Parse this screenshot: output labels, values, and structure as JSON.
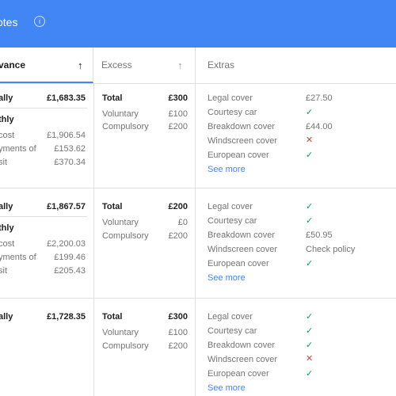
{
  "header": {
    "title": "otes",
    "info_icon": "info-icon"
  },
  "columns": {
    "advance": "vance",
    "excess": "Excess",
    "extras": "Extras",
    "sort_arrow": "↑"
  },
  "quotes": [
    {
      "annual_label": "ally",
      "annual_price": "£1,683.35",
      "monthly": {
        "label": "thly",
        "lines": [
          {
            "label": "cost",
            "value": "£1,906.54"
          },
          {
            "label": "yments of",
            "value": "£153.62"
          },
          {
            "label": "sit",
            "value": "£370.34"
          }
        ]
      },
      "excess": {
        "total_label": "Total",
        "total": "£300",
        "voluntary_label": "Voluntary",
        "voluntary": "£100",
        "compulsory_label": "Compulsory",
        "compulsory": "£200"
      },
      "extras": [
        {
          "label": "Legal cover",
          "value": "£27.50",
          "kind": "text"
        },
        {
          "label": "Courtesy car",
          "value": "✓",
          "kind": "yes"
        },
        {
          "label": "Breakdown cover",
          "value": "£44.00",
          "kind": "text"
        },
        {
          "label": "Windscreen cover",
          "value": "✕",
          "kind": "no"
        },
        {
          "label": "European cover",
          "value": "✓",
          "kind": "yes"
        }
      ],
      "see_more": "See more"
    },
    {
      "annual_label": "ally",
      "annual_price": "£1,867.57",
      "monthly": {
        "label": "thly",
        "lines": [
          {
            "label": "cost",
            "value": "£2,200.03"
          },
          {
            "label": "yments of",
            "value": "£199.46"
          },
          {
            "label": "sit",
            "value": "£205.43"
          }
        ]
      },
      "excess": {
        "total_label": "Total",
        "total": "£200",
        "voluntary_label": "Voluntary",
        "voluntary": "£0",
        "compulsory_label": "Compulsory",
        "compulsory": "£200"
      },
      "extras": [
        {
          "label": "Legal cover",
          "value": "✓",
          "kind": "yes"
        },
        {
          "label": "Courtesy car",
          "value": "✓",
          "kind": "yes"
        },
        {
          "label": "Breakdown cover",
          "value": "£50.95",
          "kind": "text"
        },
        {
          "label": "Windscreen cover",
          "value": "Check policy",
          "kind": "text"
        },
        {
          "label": "European cover",
          "value": "✓",
          "kind": "yes"
        }
      ],
      "see_more": "See more"
    },
    {
      "annual_label": "ally",
      "annual_price": "£1,728.35",
      "excess": {
        "total_label": "Total",
        "total": "£300",
        "voluntary_label": "Voluntary",
        "voluntary": "£100",
        "compulsory_label": "Compulsory",
        "compulsory": "£200"
      },
      "extras": [
        {
          "label": "Legal cover",
          "value": "✓",
          "kind": "yes"
        },
        {
          "label": "Courtesy car",
          "value": "✓",
          "kind": "yes"
        },
        {
          "label": "Breakdown cover",
          "value": "✓",
          "kind": "yes"
        },
        {
          "label": "Windscreen cover",
          "value": "✕",
          "kind": "no"
        },
        {
          "label": "European cover",
          "value": "✓",
          "kind": "yes"
        }
      ],
      "see_more": "See more"
    }
  ]
}
